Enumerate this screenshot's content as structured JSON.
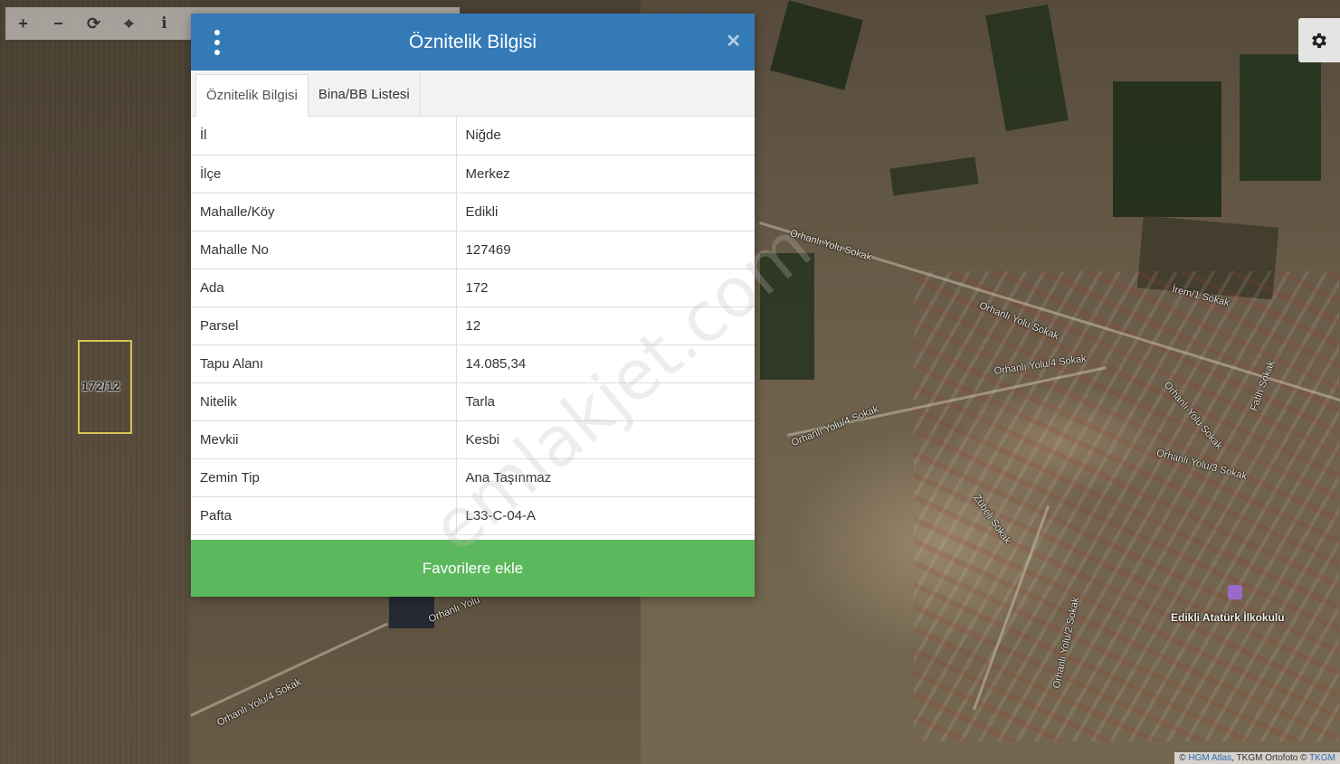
{
  "toolbar": {
    "zoom_in_glyph": "+",
    "zoom_out_glyph": "−",
    "refresh_glyph": "⟳",
    "locate_glyph": "⌖",
    "info_glyph": "i"
  },
  "dialog": {
    "title": "Öznitelik Bilgisi",
    "close_glyph": "✕",
    "tabs": [
      {
        "label": "Öznitelik Bilgisi",
        "active": true
      },
      {
        "label": "Bina/BB Listesi",
        "active": false
      }
    ],
    "rows": [
      {
        "key": "İl",
        "value": "Niğde"
      },
      {
        "key": "İlçe",
        "value": "Merkez"
      },
      {
        "key": "Mahalle/Köy",
        "value": "Edikli"
      },
      {
        "key": "Mahalle No",
        "value": "127469"
      },
      {
        "key": "Ada",
        "value": "172"
      },
      {
        "key": "Parsel",
        "value": "12"
      },
      {
        "key": "Tapu Alanı",
        "value": "14.085,34"
      },
      {
        "key": "Nitelik",
        "value": "Tarla"
      },
      {
        "key": "Mevkii",
        "value": "Kesbi"
      },
      {
        "key": "Zemin Tip",
        "value": "Ana Taşınmaz"
      },
      {
        "key": "Pafta",
        "value": "L33-C-04-A"
      }
    ],
    "favorite_button": "Favorilere ekle"
  },
  "map": {
    "parcel_label": "172/12",
    "road_labels": [
      "Orhanlı Yolu Sokak",
      "Orhanlı Yolu Sokak",
      "İrem/1 Sokak",
      "Orhanlı Yolu/4 Sokak",
      "Orhanlı Yolu/4 Sokak",
      "Orhanlı Yolu Sokak",
      "Orhanlı Yolu/3 Sokak",
      "Fatih Sokak",
      "Zübeli Sokak",
      "Orhanlı Yolu/2 Sokak",
      "Orhanlı Yolu",
      "Orhanlı Yolu/4 Sokak"
    ],
    "school_label": "Edikli Atatürk İlkokulu",
    "attribution_prefix": "© ",
    "attribution_link1": "HGM Atlas",
    "attribution_mid": ", TKGM Ortofoto © ",
    "attribution_link2": "TKGM"
  },
  "watermark": "emlakjet.com",
  "colors": {
    "header_blue": "#337ab7",
    "button_green": "#5cb85c",
    "parcel_outline": "#d7c457"
  }
}
